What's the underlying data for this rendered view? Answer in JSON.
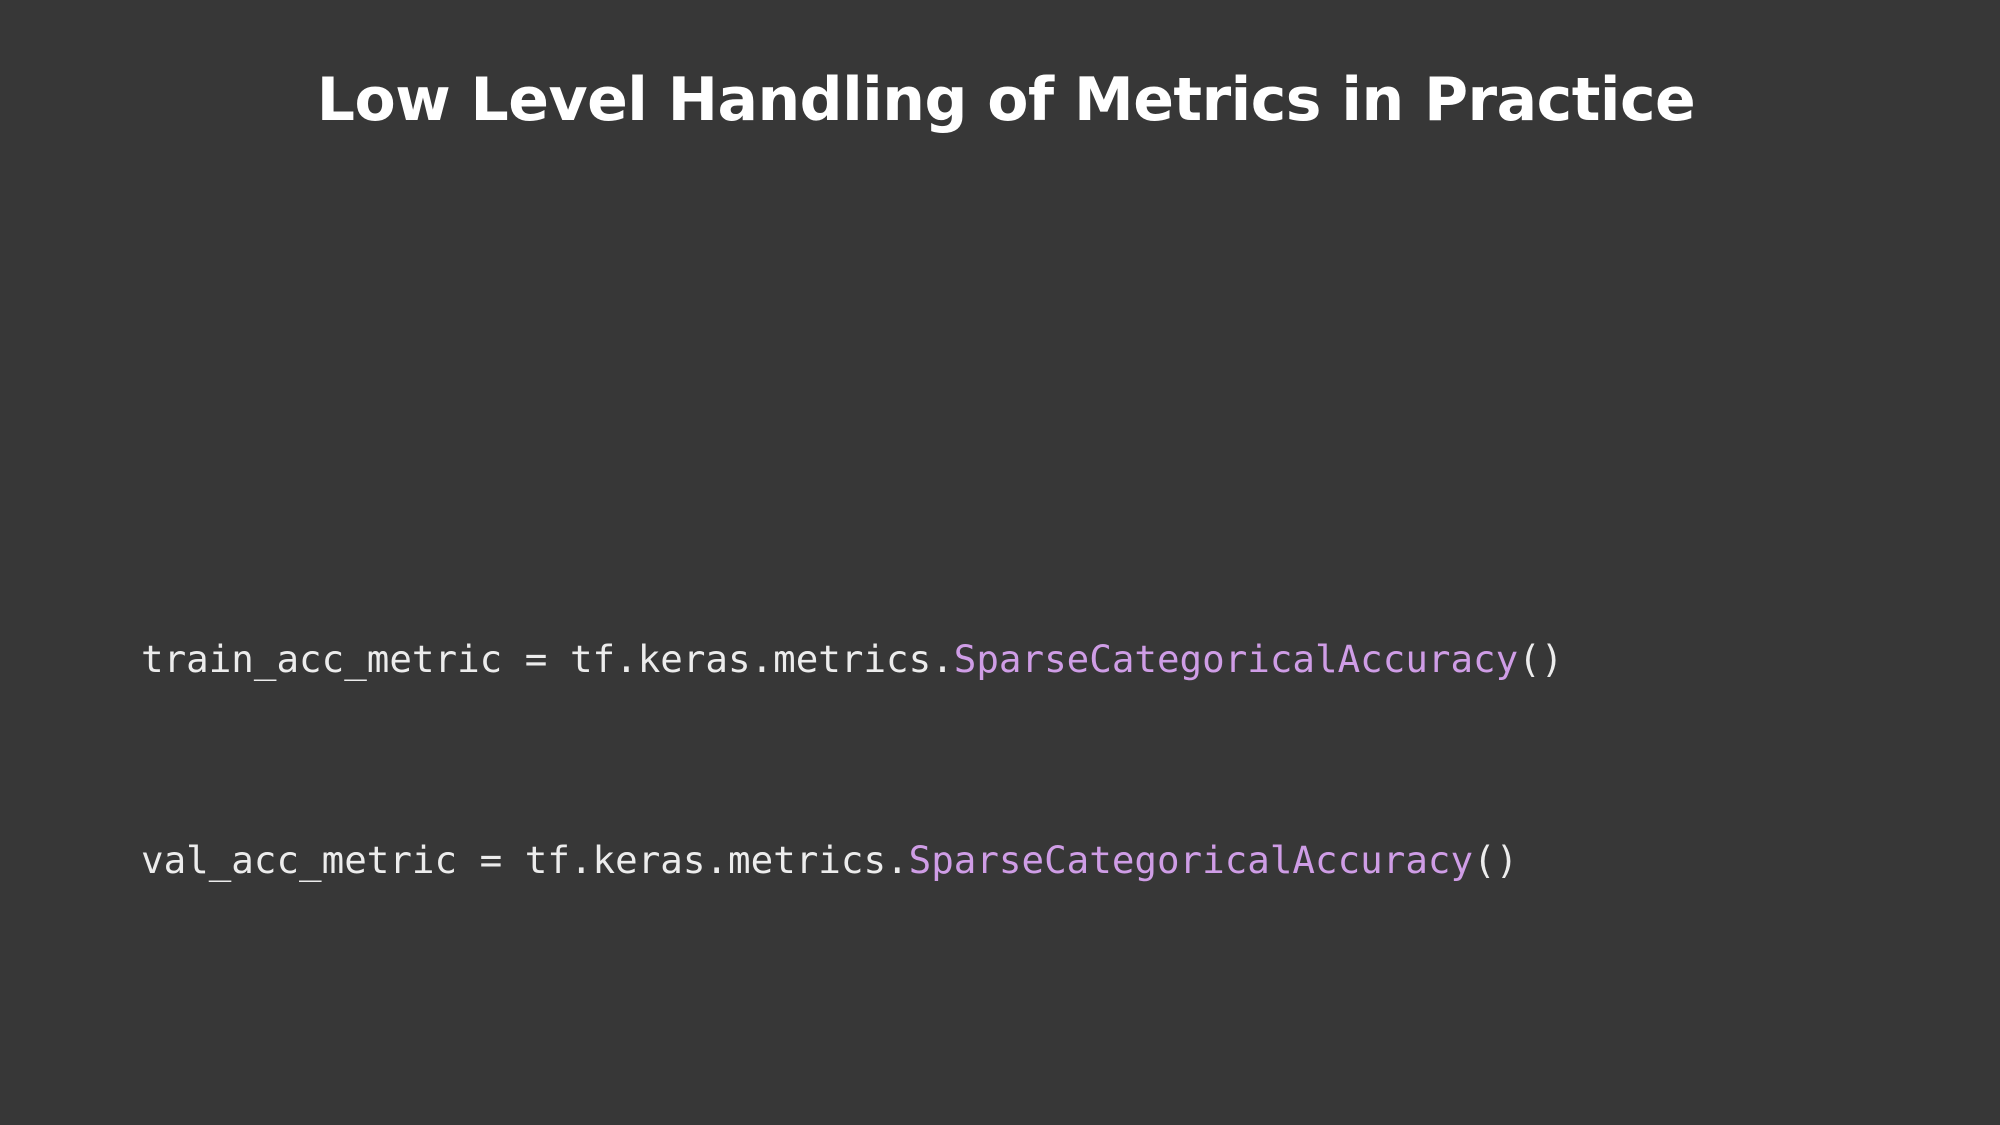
{
  "slide": {
    "title": "Low Level Handling of Metrics in Practice"
  },
  "code": {
    "lines": [
      {
        "prefix": "train_acc_metric = tf.keras.metrics.",
        "class_name": "SparseCategoricalAccuracy",
        "suffix": "()"
      },
      {
        "prefix": "val_acc_metric = tf.keras.metrics.",
        "class_name": "SparseCategoricalAccuracy",
        "suffix": "()"
      }
    ]
  },
  "colors": {
    "background": "#373737",
    "title": "#ffffff",
    "code_text": "#ececec",
    "code_class_highlight": "#cf9de6"
  }
}
